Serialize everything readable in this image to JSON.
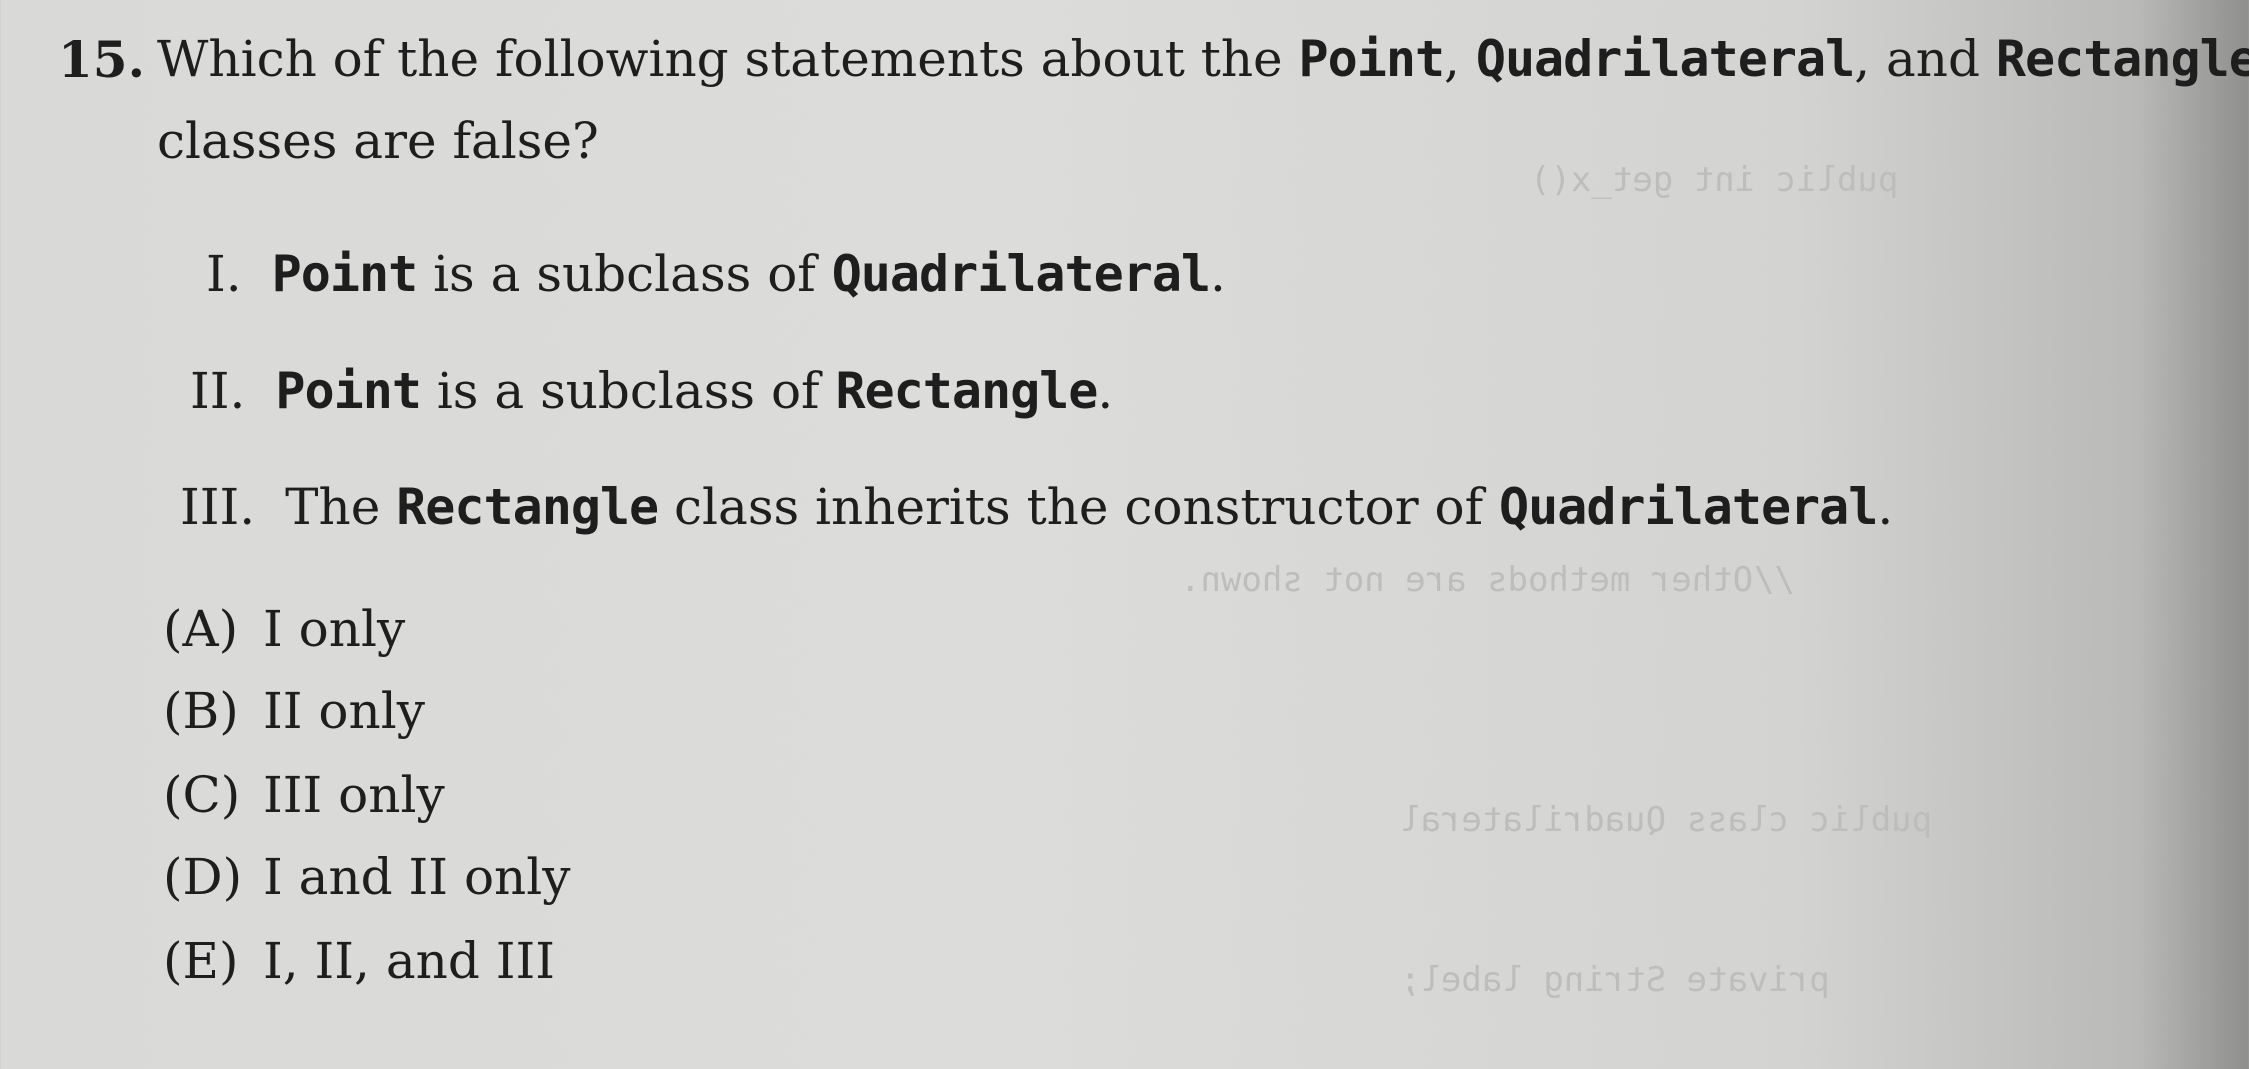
{
  "question": {
    "number": "15.",
    "stem_part1": "Which of the following statements about the ",
    "code_point": "Point",
    "sep1": ", ",
    "code_quadrilateral": "Quadrilateral",
    "sep2": ", and ",
    "code_rectangle": "Rectangle",
    "stem_part2": "classes are false?"
  },
  "statements": [
    {
      "numeral": "I.",
      "code_a": "Point",
      "text_mid": " is a subclass of ",
      "code_b": "Quadrilateral",
      "text_end": "."
    },
    {
      "numeral": "II.",
      "code_a": "Point",
      "text_mid": " is a subclass of ",
      "code_b": "Rectangle",
      "text_end": "."
    },
    {
      "numeral": "III.",
      "text_start": "The ",
      "code_a": "Rectangle",
      "text_mid": " class inherits the constructor of ",
      "code_b": "Quadrilateral",
      "text_end": "."
    }
  ],
  "choices": [
    {
      "letter": "(A)",
      "text": "I only"
    },
    {
      "letter": "(B)",
      "text": "II only"
    },
    {
      "letter": "(C)",
      "text": "III only"
    },
    {
      "letter": "(D)",
      "text": "I and II only"
    },
    {
      "letter": "(E)",
      "text": "I, II, and III"
    }
  ]
}
